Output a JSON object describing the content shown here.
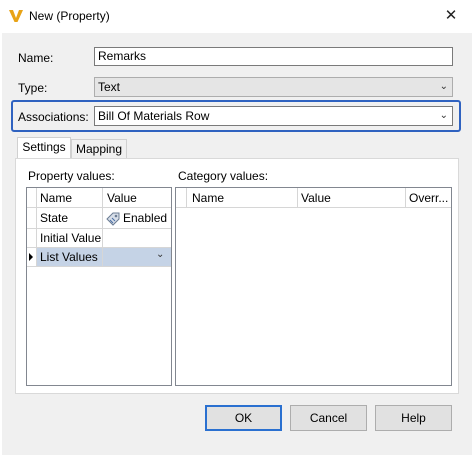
{
  "window": {
    "title": "New (Property)",
    "close_glyph": "✕"
  },
  "form": {
    "name_label": "Name:",
    "name_value": "Remarks",
    "type_label": "Type:",
    "type_value": "Text",
    "associations_label": "Associations:",
    "associations_value": "Bill Of Materials Row"
  },
  "tabs": [
    {
      "label": "Settings",
      "active": true
    },
    {
      "label": "Mapping",
      "active": false
    }
  ],
  "property_values": {
    "label": "Property values:",
    "columns": [
      "Name",
      "Value"
    ],
    "rows": [
      {
        "name": "State",
        "value": "Enabled",
        "icon": "tag-icon"
      },
      {
        "name": "Initial Value",
        "value": ""
      },
      {
        "name": "List Values",
        "value": "",
        "selected": true
      }
    ]
  },
  "category_values": {
    "label": "Category values:",
    "columns": [
      "Name",
      "Value",
      "Overr..."
    ]
  },
  "buttons": {
    "ok": "OK",
    "cancel": "Cancel",
    "help": "Help"
  },
  "colors": {
    "accent": "#2f62c0",
    "selection": "#c5d3e6",
    "logo": "#e8a317"
  }
}
